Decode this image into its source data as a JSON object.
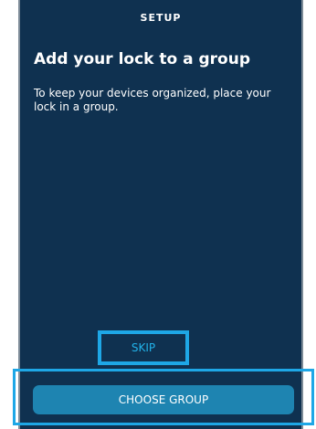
{
  "header": {
    "title": "SETUP"
  },
  "main": {
    "title": "Add your lock to a group",
    "description": "To keep your devices organized, place your lock in a group."
  },
  "actions": {
    "skip_label": "SKIP",
    "choose_group_label": "CHOOSE GROUP"
  },
  "colors": {
    "background": "#0f3150",
    "accent": "#1e84b1",
    "highlight": "#1ea7e6"
  }
}
